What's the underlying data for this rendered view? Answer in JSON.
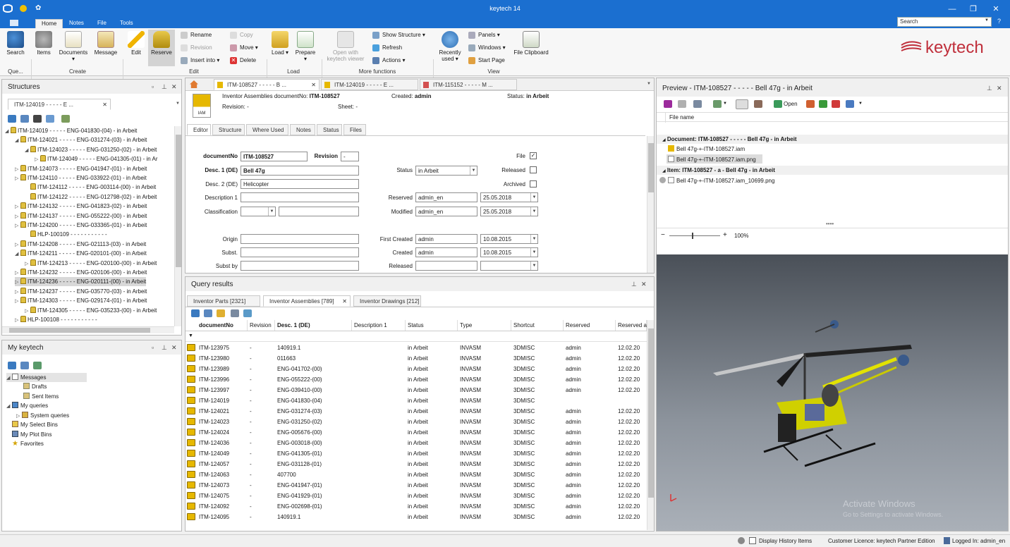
{
  "window": {
    "title": "keytech 14"
  },
  "menu": {
    "home": "Home",
    "notes": "Notes",
    "file": "File",
    "tools": "Tools"
  },
  "search": {
    "placeholder": "Search"
  },
  "ribbon": {
    "search": "Search",
    "items": "Items",
    "documents": "Documents",
    "message": "Message",
    "edit": "Edit",
    "reserve": "Reserve",
    "rename": "Rename",
    "revision": "Revision",
    "insert_into": "Insert into",
    "copy": "Copy",
    "move": "Move",
    "delete": "Delete",
    "load": "Load",
    "prepare": "Prepare",
    "open_with_1": "Open with",
    "open_with_2": "keytech viewer",
    "show_structure": "Show Structure",
    "refresh": "Refresh",
    "actions": "Actions",
    "recently_1": "Recently",
    "recently_2": "used",
    "panels": "Panels",
    "windows": "Windows",
    "start_page": "Start Page",
    "file_clipboard": "File Clipboard",
    "groups": {
      "que": "Que...",
      "create": "Create",
      "edit": "Edit",
      "load": "Load",
      "more": "More functions",
      "view": "View"
    }
  },
  "brand": "keytech",
  "structures": {
    "title": "Structures",
    "tab": "ITM-124019 - - - - - E ...",
    "rows": [
      "ITM-124019 - - - - - ENG-041830-(04) - in Arbeit",
      "ITM-124021 - - - - - ENG-031274-(03) - in Arbeit",
      "ITM-124023 - - - - - ENG-031250-(02) - in Arbeit",
      "ITM-124049 - - - - - ENG-041305-(01) - in Ar",
      "ITM-124073 - - - - - ENG-041947-(01) - in Arbeit",
      "ITM-124110 - - - - - ENG-033922-(01) - in Arbeit",
      "ITM-124112 - - - - - ENG-003114-(00) - in Arbeit",
      "ITM-124122 - - - - - ENG-012798-(02) - in Arbeit",
      "ITM-124132 - - - - - ENG-041823-(02) - in Arbeit",
      "ITM-124137 - - - - - ENG-055222-(00) - in Arbeit",
      "ITM-124200 - - - - - ENG-033365-(01) - in Arbeit",
      "HLP-100109 - - - - - - - - - - -",
      "ITM-124208 - - - - - ENG-021113-(03) - in Arbeit",
      "ITM-124211 - - - - - ENG-020101-(00) - in Arbeit",
      "ITM-124213 - - - - - ENG-020100-(00) - in Arbeit",
      "ITM-124232 - - - - - ENG-020106-(00) - in Arbeit",
      "ITM-124236 - - - - - ENG-020111-(00) - in Arbeit",
      "ITM-124237 - - - - - ENG-035770-(03) - in Arbeit",
      "ITM-124303 - - - - - ENG-029174-(01) - in Arbeit",
      "ITM-124305 - - - - - ENG-035233-(00) - in Arbeit",
      "HLP-100108 - - - - - - - - - - -"
    ]
  },
  "mykeytech": {
    "title": "My keytech",
    "items": [
      "Messages",
      "Drafts",
      "Sent Items",
      "My queries",
      "System queries",
      "My Select Bins",
      "My Plot Bins",
      "Favorites"
    ]
  },
  "doctabs": [
    "ITM-108527 - - - - - B ...",
    "ITM-124019 - - - - - E ...",
    "ITM-115152 - - - - - M ..."
  ],
  "header": {
    "title_prefix": "Inventor Assemblies  documentNo:",
    "docno": "ITM-108527",
    "created_label": "Created:",
    "created_value": "admin",
    "status_label": "Status:",
    "status_value": "in Arbeit",
    "revision": "Revision: -",
    "sheet": "Sheet: -",
    "icon_label": "IAM"
  },
  "editor_tabs": [
    "Editor",
    "Structure",
    "Where Used",
    "Notes",
    "Status",
    "Files"
  ],
  "form": {
    "documentno_label": "documentNo",
    "documentno": "ITM-108527",
    "revision_label": "Revision",
    "revision": "-",
    "desc1_label": "Desc. 1 (DE)",
    "desc1": "Bell 47g",
    "desc2_label": "Desc. 2 (DE)",
    "desc2": "Helicopter",
    "description1_label": "Description 1",
    "classification_label": "Classification",
    "origin_label": "Origin",
    "subst_label": "Subst.",
    "substby_label": "Subst by",
    "status_label": "Status",
    "status": "in Arbeit",
    "reserved_label": "Reserved",
    "reserved_user": "admin_en",
    "reserved_date": "25.05.2018",
    "modified_label": "Modified",
    "modified_user": "admin_en",
    "modified_date": "25.05.2018",
    "first_created_label": "First Created",
    "first_created_user": "admin",
    "first_created_date": "10.08.2015",
    "created_label": "Created",
    "created_user": "admin",
    "created_date": "10.08.2015",
    "released_label": "Released",
    "file_label": "File",
    "file_checked": true,
    "released_cb_label": "Released",
    "archived_label": "Archived"
  },
  "query": {
    "title": "Query results",
    "tabs": [
      "Inventor Parts [2321]",
      "Inventor Assemblies [789]",
      "Inventor Drawings [212]"
    ],
    "columns": [
      "documentNo",
      "Revision",
      "Desc. 1 (DE)",
      "Description 1",
      "Status",
      "Type",
      "Shortcut",
      "Reserved",
      "Reserved at"
    ],
    "rows": [
      [
        "ITM-123975",
        "-",
        "140919.1",
        "in Arbeit",
        "INVASM",
        "3DMISC",
        "admin",
        "12.02.20"
      ],
      [
        "ITM-123980",
        "-",
        "011663",
        "in Arbeit",
        "INVASM",
        "3DMISC",
        "admin",
        "12.02.20"
      ],
      [
        "ITM-123989",
        "-",
        "ENG-041702-(00)",
        "in Arbeit",
        "INVASM",
        "3DMISC",
        "admin",
        "12.02.20"
      ],
      [
        "ITM-123996",
        "-",
        "ENG-055222-(00)",
        "in Arbeit",
        "INVASM",
        "3DMISC",
        "admin",
        "12.02.20"
      ],
      [
        "ITM-123997",
        "-",
        "ENG-039410-(00)",
        "in Arbeit",
        "INVASM",
        "3DMISC",
        "admin",
        "12.02.20"
      ],
      [
        "ITM-124019",
        "-",
        "ENG-041830-(04)",
        "in Arbeit",
        "INVASM",
        "3DMISC",
        "",
        ""
      ],
      [
        "ITM-124021",
        "-",
        "ENG-031274-(03)",
        "in Arbeit",
        "INVASM",
        "3DMISC",
        "admin",
        "12.02.20"
      ],
      [
        "ITM-124023",
        "-",
        "ENG-031250-(02)",
        "in Arbeit",
        "INVASM",
        "3DMISC",
        "admin",
        "12.02.20"
      ],
      [
        "ITM-124024",
        "-",
        "ENG-005676-(00)",
        "in Arbeit",
        "INVASM",
        "3DMISC",
        "admin",
        "12.02.20"
      ],
      [
        "ITM-124036",
        "-",
        "ENG-003018-(00)",
        "in Arbeit",
        "INVASM",
        "3DMISC",
        "admin",
        "12.02.20"
      ],
      [
        "ITM-124049",
        "-",
        "ENG-041305-(01)",
        "in Arbeit",
        "INVASM",
        "3DMISC",
        "admin",
        "12.02.20"
      ],
      [
        "ITM-124057",
        "-",
        "ENG-031128-(01)",
        "in Arbeit",
        "INVASM",
        "3DMISC",
        "admin",
        "12.02.20"
      ],
      [
        "ITM-124063",
        "-",
        "407700",
        "in Arbeit",
        "INVASM",
        "3DMISC",
        "admin",
        "12.02.20"
      ],
      [
        "ITM-124073",
        "-",
        "ENG-041947-(01)",
        "in Arbeit",
        "INVASM",
        "3DMISC",
        "admin",
        "12.02.20"
      ],
      [
        "ITM-124075",
        "-",
        "ENG-041929-(01)",
        "in Arbeit",
        "INVASM",
        "3DMISC",
        "admin",
        "12.02.20"
      ],
      [
        "ITM-124092",
        "-",
        "ENG-002698-(01)",
        "in Arbeit",
        "INVASM",
        "3DMISC",
        "admin",
        "12.02.20"
      ],
      [
        "ITM-124095",
        "-",
        "140919.1",
        "in Arbeit",
        "INVASM",
        "3DMISC",
        "admin",
        "12.02.20"
      ]
    ]
  },
  "preview": {
    "title": "Preview - ITM-108527 - - - - - Bell 47g - in Arbeit",
    "open": "Open",
    "file_name_header": "File name",
    "doc_group": "Document: ITM-108527 - - - - - Bell 47g - in Arbeit",
    "file1": "Bell 47g-+-ITM-108527.iam",
    "file2": "Bell 47g-+-ITM-108527.iam.png",
    "item_group": "Item: ITM-108527 - a - Bell 47g - in Arbeit",
    "file3": "Bell 47g-+-ITM-108527.iam_10699.png",
    "zoom": "100%",
    "zoom_level": 0.45,
    "watermark1": "Activate Windows",
    "watermark2": "Go to Settings to activate Windows."
  },
  "status": {
    "history": "Display History Items",
    "licence": "Customer Licence: keytech Partner Edition",
    "logged": "Logged In: admin_en"
  },
  "colors": {
    "accent": "#1b6fd0",
    "brand": "#c0303c"
  }
}
